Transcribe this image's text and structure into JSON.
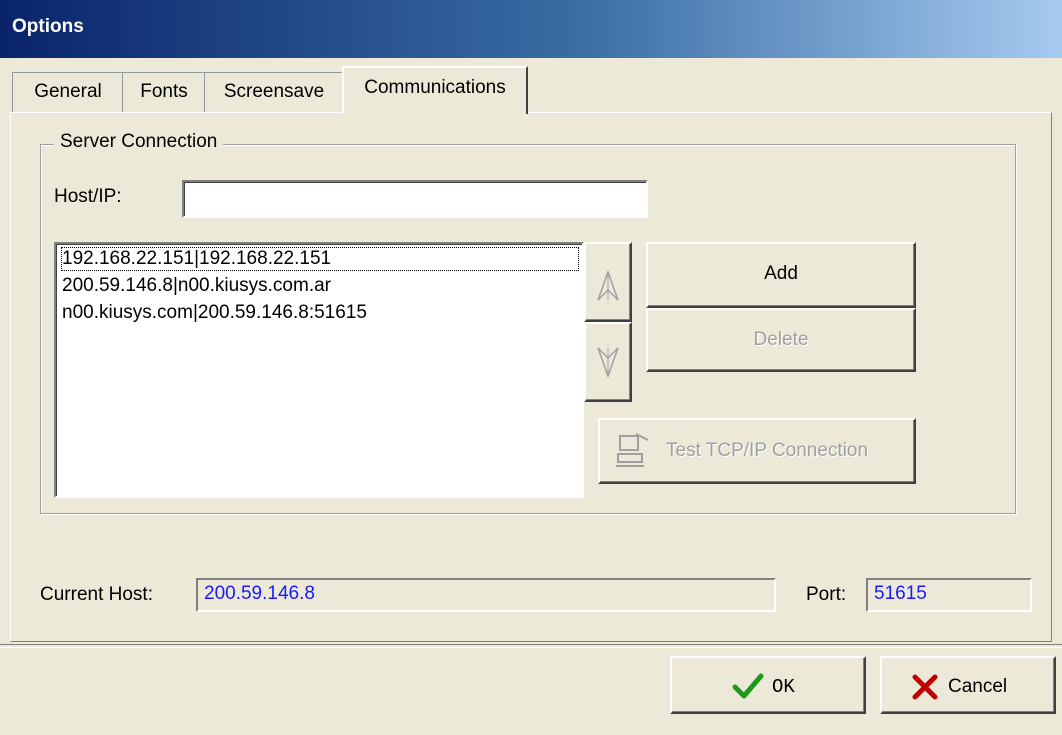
{
  "window": {
    "title": "Options"
  },
  "tabs": [
    {
      "label": "General"
    },
    {
      "label": "Fonts"
    },
    {
      "label": "Screensave"
    },
    {
      "label": "Communications",
      "active": true
    }
  ],
  "server_connection": {
    "legend": "Server Connection",
    "host_label": "Host/IP:",
    "host_value": "",
    "servers": [
      "192.168.22.151|192.168.22.151",
      "200.59.146.8|n00.kiusys.com.ar",
      "n00.kiusys.com|200.59.146.8:51615"
    ],
    "selected_index": 0,
    "add_label": "Add",
    "delete_label": "Delete",
    "test_label": "Test TCP/IP Connection"
  },
  "status": {
    "current_host_label": "Current Host:",
    "current_host_value": "200.59.146.8",
    "port_label": "Port:",
    "port_value": "51615"
  },
  "footer": {
    "ok_label": "OK",
    "cancel_label": "Cancel"
  },
  "colors": {
    "title_start": "#0a246a",
    "title_end": "#a6caf0",
    "value_text": "#1a1aff",
    "ok_check": "#1a9a1a",
    "cancel_x": "#c00000"
  }
}
